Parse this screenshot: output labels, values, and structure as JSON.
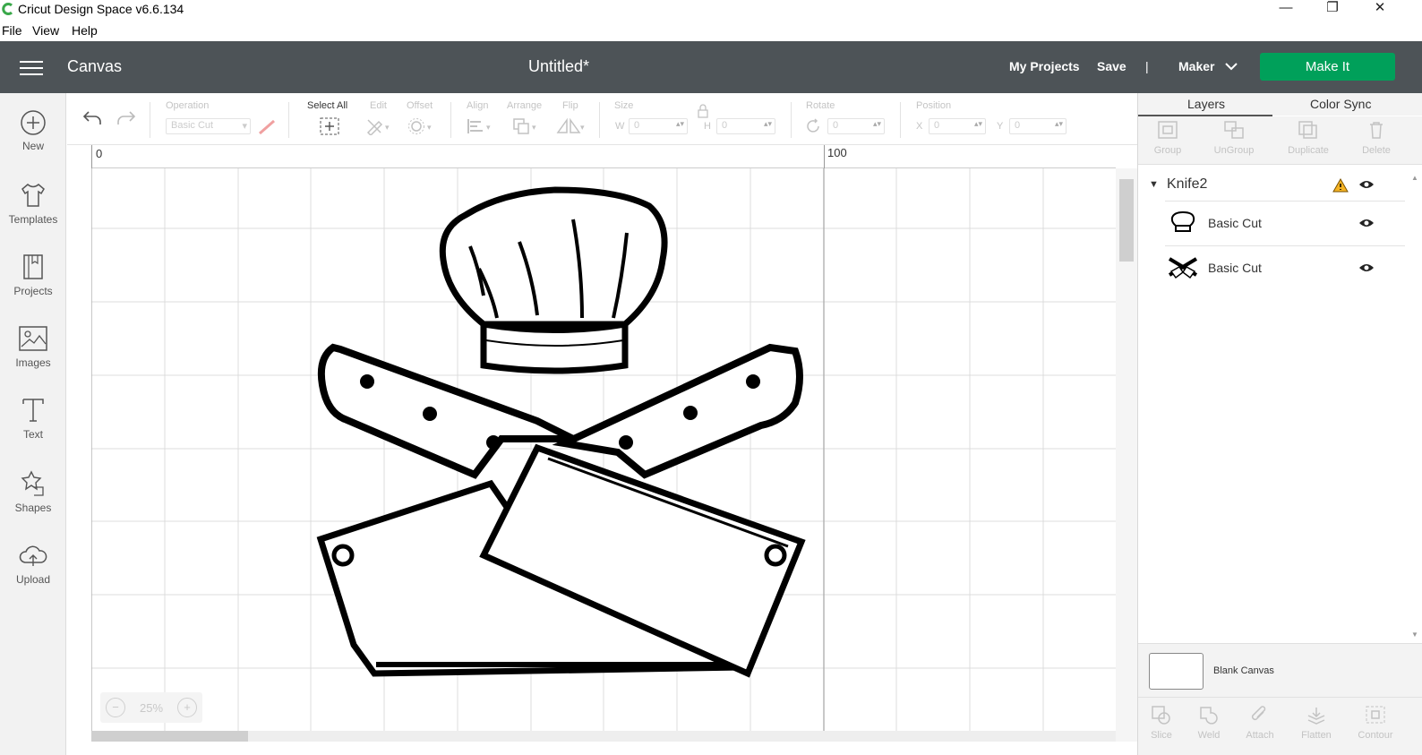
{
  "window": {
    "title": "Cricut Design Space  v6.6.134",
    "controls": {
      "minimize": "—",
      "restore": "❐",
      "close": "✕"
    }
  },
  "menu": [
    "File",
    "View",
    "Help"
  ],
  "header": {
    "section": "Canvas",
    "document_title": "Untitled*",
    "my_projects": "My Projects",
    "save": "Save",
    "separator": "|",
    "machine": "Maker",
    "make_it": "Make It",
    "make_it_color": "#00a05a",
    "bar_color": "#4d5357"
  },
  "sidebar": [
    {
      "label": "New",
      "icon": "plus-circle-icon"
    },
    {
      "label": "Templates",
      "icon": "tshirt-icon"
    },
    {
      "label": "Projects",
      "icon": "book-icon"
    },
    {
      "label": "Images",
      "icon": "image-icon"
    },
    {
      "label": "Text",
      "icon": "text-icon"
    },
    {
      "label": "Shapes",
      "icon": "shapes-icon"
    },
    {
      "label": "Upload",
      "icon": "cloud-upload-icon"
    }
  ],
  "toolbar": {
    "operation_label": "Operation",
    "operation_value": "Basic Cut",
    "select_all": "Select All",
    "edit": "Edit",
    "offset": "Offset",
    "align": "Align",
    "arrange": "Arrange",
    "flip": "Flip",
    "size": "Size",
    "w_label": "W",
    "w_value": "0",
    "h_label": "H",
    "h_value": "0",
    "rotate": "Rotate",
    "rotate_value": "0",
    "position": "Position",
    "x_label": "X",
    "x_value": "0",
    "y_label": "Y",
    "y_value": "0"
  },
  "ruler": {
    "start": "0",
    "mark_100": "100"
  },
  "zoom": {
    "value": "25%",
    "minus": "−",
    "plus": "+"
  },
  "panel": {
    "tabs": [
      "Layers",
      "Color Sync"
    ],
    "tools": [
      "Group",
      "UnGroup",
      "Duplicate",
      "Delete"
    ],
    "group_name": "Knife2",
    "layers": [
      {
        "name": "Basic Cut",
        "thumb": "chef-hat-thumb"
      },
      {
        "name": "Basic Cut",
        "thumb": "crossed-cleavers-thumb"
      }
    ],
    "blank_canvas": "Blank Canvas",
    "bottom_tools": [
      "Slice",
      "Weld",
      "Attach",
      "Flatten",
      "Contour"
    ]
  }
}
